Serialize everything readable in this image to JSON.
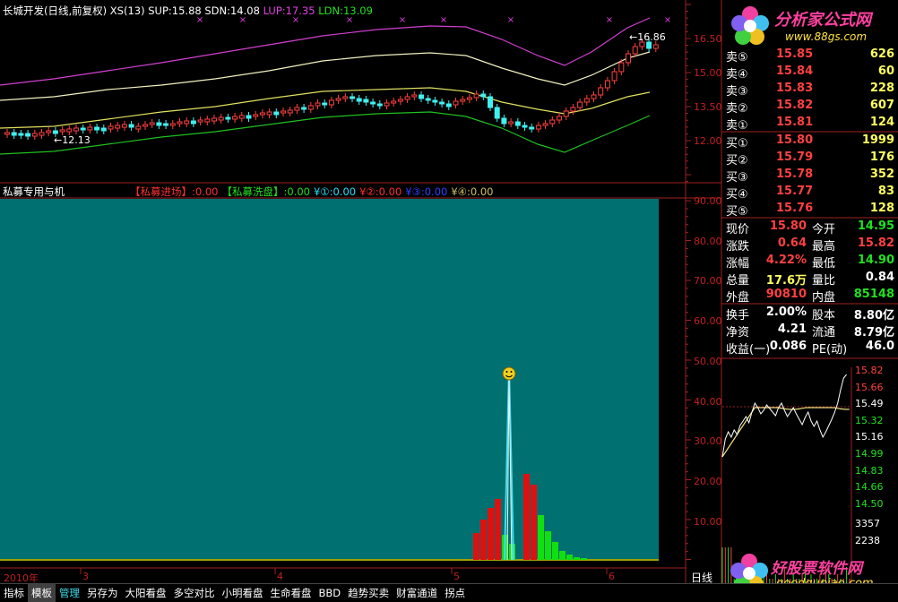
{
  "main_chart": {
    "stock_name": "长城开发",
    "period": "(日线,前复权)",
    "indicator": "XS(13)",
    "sup": "SUP:15.88",
    "sdn": "SDN:14.08",
    "lup": "LUP:17.35",
    "ldn": "LDN:13.09",
    "price_ticks": [
      "16.50",
      "15.00",
      "13.50",
      "12.00"
    ],
    "low_marker": "12.13",
    "high_marker": "16.86"
  },
  "sub_chart": {
    "title": "私募专用与机",
    "legend": [
      {
        "label": "【私募进场】",
        "value": ":0.00",
        "color": "#ff3030"
      },
      {
        "label": "【私募洗盘】",
        "value": ":0.00",
        "color": "#20e020"
      },
      {
        "label": "¥①",
        "value": ":0.00",
        "color": "#20e0ff"
      },
      {
        "label": "¥②",
        "value": ":0.00",
        "color": "#ff3030"
      },
      {
        "label": "¥③",
        "value": ":0.00",
        "color": "#3040ff"
      },
      {
        "label": "¥④",
        "value": ":0.00",
        "color": "#d0c060"
      }
    ],
    "y_ticks": [
      "90.00",
      "80.00",
      "70.00",
      "60.00",
      "50.00",
      "40.00",
      "30.00",
      "20.00",
      "10.00"
    ],
    "x_labels": [
      "2010年",
      "3",
      "4",
      "5",
      "6"
    ],
    "bottom_right_label": "日线"
  },
  "logo_top": {
    "text": "分析家公式网",
    "url": "www.88gs.com"
  },
  "logo_bottom": {
    "text": "好股票软件网",
    "url": "goodgupiao.com"
  },
  "order_book": {
    "asks": [
      {
        "label": "卖⑤",
        "price": "15.85",
        "vol": "626"
      },
      {
        "label": "卖④",
        "price": "15.84",
        "vol": "60"
      },
      {
        "label": "卖③",
        "price": "15.83",
        "vol": "228"
      },
      {
        "label": "卖②",
        "price": "15.82",
        "vol": "607"
      },
      {
        "label": "卖①",
        "price": "15.81",
        "vol": "124"
      }
    ],
    "bids": [
      {
        "label": "买①",
        "price": "15.80",
        "vol": "1999"
      },
      {
        "label": "买②",
        "price": "15.79",
        "vol": "176"
      },
      {
        "label": "买③",
        "price": "15.78",
        "vol": "352"
      },
      {
        "label": "买④",
        "price": "15.77",
        "vol": "83"
      },
      {
        "label": "买⑤",
        "price": "15.76",
        "vol": "128"
      }
    ]
  },
  "stats": [
    {
      "l1": "现价",
      "v1": "15.80",
      "c1": "#ff4040",
      "l2": "今开",
      "v2": "14.95",
      "c2": "#20e020"
    },
    {
      "l1": "涨跌",
      "v1": "0.64",
      "c1": "#ff4040",
      "l2": "最高",
      "v2": "15.82",
      "c2": "#ff4040"
    },
    {
      "l1": "涨幅",
      "v1": "4.22%",
      "c1": "#ff4040",
      "l2": "最低",
      "v2": "14.90",
      "c2": "#20e020"
    },
    {
      "l1": "总量",
      "v1": "17.6万",
      "c1": "#ffff60",
      "l2": "量比",
      "v2": "0.84",
      "c2": "#ffffff"
    },
    {
      "l1": "外盘",
      "v1": "90810",
      "c1": "#ff4040",
      "l2": "内盘",
      "v2": "85148",
      "c2": "#20e020"
    },
    {
      "l1": "换手",
      "v1": "2.00%",
      "c1": "#ffffff",
      "l2": "股本",
      "v2": "8.80亿",
      "c2": "#ffffff"
    },
    {
      "l1": "净资",
      "v1": "4.21",
      "c1": "#ffffff",
      "l2": "流通",
      "v2": "8.79亿",
      "c2": "#ffffff"
    },
    {
      "l1": "收益(一)",
      "v1": "0.086",
      "c1": "#ffffff",
      "l2": "PE(动)",
      "v2": "46.0",
      "c2": "#ffffff"
    }
  ],
  "mini_chart": {
    "ticks": [
      "15.82",
      "15.66",
      "15.49",
      "15.32",
      "15.16",
      "14.99",
      "14.83",
      "14.66",
      "14.50"
    ],
    "vol_ticks": [
      "3357",
      "2238"
    ]
  },
  "tabs": [
    "指标",
    "模板",
    "管理",
    "另存为",
    "大阳看盘",
    "多空对比",
    "小明看盘",
    "生命看盘",
    "BBD",
    "趋势买卖",
    "财富通道",
    "拐点"
  ]
}
